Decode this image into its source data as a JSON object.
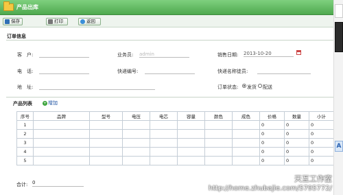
{
  "window": {
    "title": "产品出库"
  },
  "toolbar": {
    "save_label": "保存",
    "print_label": "打印",
    "back_label": "返回"
  },
  "order_section": {
    "title": "订单信息",
    "customer_label": "客　户:",
    "customer_value": "",
    "salesman_label": "业务员:",
    "salesman_value": "admin",
    "sale_date_label": "销售日期:",
    "sale_date_value": "2013-10-20",
    "phone_label": "电　话:",
    "phone_value": "",
    "courier_no_label": "快递编号:",
    "courier_no_value": "",
    "courier_name_label": "快递名称徒员:",
    "courier_name_value": "",
    "address_label": "地　址:",
    "address_value": "",
    "status_label": "订单状态:",
    "status_options": [
      "发货",
      "配送"
    ],
    "status_selected": "发货"
  },
  "product_section": {
    "title": "产品列表",
    "add_label": "增加",
    "columns": [
      "序号",
      "品牌",
      "型号",
      "电压",
      "电芯",
      "容量",
      "颜色",
      "成色",
      "价格",
      "数量",
      "小计"
    ],
    "rows": [
      {
        "no": "1",
        "price": "0",
        "qty": "0",
        "subtotal": "0"
      },
      {
        "no": "2",
        "price": "0",
        "qty": "0",
        "subtotal": "0"
      },
      {
        "no": "3",
        "price": "0",
        "qty": "0",
        "subtotal": "0"
      },
      {
        "no": "4",
        "price": "0",
        "qty": "0",
        "subtotal": "0"
      },
      {
        "no": "5",
        "price": "0",
        "qty": "0",
        "subtotal": "0"
      }
    ]
  },
  "total": {
    "label": "合计:",
    "value": "0"
  },
  "watermark": {
    "line1": "天互工作室",
    "line2": "http://home.zhubajie.com/5795772/"
  },
  "colors": {
    "titlebar": "#4fa94f",
    "accent": "#2a62b2"
  }
}
